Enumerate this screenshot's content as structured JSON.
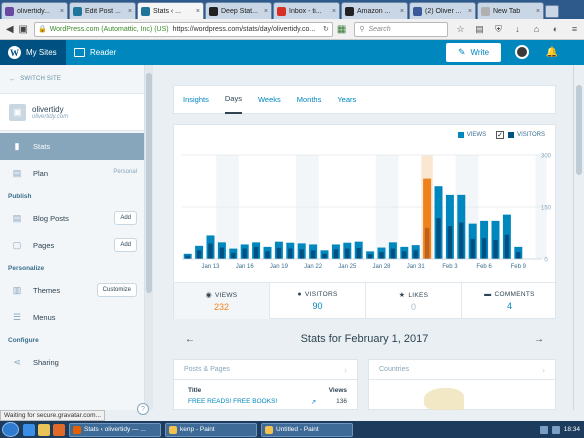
{
  "browser": {
    "tabs": [
      {
        "title": "olivertidy...",
        "favicon_color": "#6a4aa0",
        "active": false
      },
      {
        "title": "Edit Post ...",
        "favicon_color": "#21759b",
        "active": false
      },
      {
        "title": "Stats ‹ ...",
        "favicon_color": "#21759b",
        "active": true
      },
      {
        "title": "Deep Stat...",
        "favicon_color": "#222222",
        "active": false
      },
      {
        "title": "Inbox - ti...",
        "favicon_color": "#d93025",
        "active": false
      },
      {
        "title": "Amazon ...",
        "favicon_color": "#222222",
        "active": false
      },
      {
        "title": "(2) Oliver ...",
        "favicon_color": "#3b5998",
        "active": false
      },
      {
        "title": "New Tab",
        "favicon_color": "#b0b0b0",
        "active": false
      }
    ],
    "identity": "WordPress.com (Automattic, Inc) (US)",
    "url": "https://wordpress.com/stats/day/olivertidy.co...",
    "search_placeholder": "Search"
  },
  "masterbar": {
    "my_sites": "My Sites",
    "reader": "Reader",
    "write": "Write"
  },
  "sidebar": {
    "switch_site": "SWITCH SITE",
    "site_name": "olivertidy",
    "site_url": "olivertidy.com",
    "stats": "Stats",
    "plan": "Plan",
    "plan_tag": "Personal",
    "publish_header": "Publish",
    "blog_posts": "Blog Posts",
    "pages": "Pages",
    "add": "Add",
    "personalize_header": "Personalize",
    "themes": "Themes",
    "customize": "Customize",
    "menus": "Menus",
    "configure_header": "Configure",
    "sharing": "Sharing"
  },
  "period_tabs": [
    "Insights",
    "Days",
    "Weeks",
    "Months",
    "Years"
  ],
  "selected_tab": "Days",
  "chart_data": {
    "type": "bar",
    "legend": [
      "VIEWS",
      "VISITORS"
    ],
    "y_ticks": [
      "300",
      "150",
      "0"
    ],
    "ylim": [
      0,
      300
    ],
    "x_tick_labels": [
      "Jan 13",
      "Jan 16",
      "Jan 19",
      "Jan 22",
      "Jan 25",
      "Jan 28",
      "Jan 31",
      "Feb 3",
      "Feb 6",
      "Feb 9"
    ],
    "x_tick_index": [
      2,
      5,
      8,
      11,
      14,
      17,
      20,
      23,
      26,
      29
    ],
    "selected_index": 21,
    "weekend_indices": [
      3,
      4,
      10,
      11,
      17,
      18,
      24,
      25,
      31
    ],
    "series": [
      {
        "name": "VIEWS",
        "values": [
          15,
          38,
          68,
          48,
          30,
          42,
          48,
          35,
          50,
          47,
          45,
          42,
          25,
          42,
          47,
          50,
          22,
          33,
          48,
          35,
          40,
          232,
          210,
          185,
          185,
          102,
          110,
          110,
          128,
          35
        ]
      },
      {
        "name": "VISITORS",
        "values": [
          10,
          25,
          45,
          33,
          18,
          30,
          35,
          22,
          32,
          30,
          28,
          25,
          15,
          28,
          30,
          32,
          14,
          20,
          30,
          22,
          25,
          90,
          118,
          95,
          105,
          58,
          60,
          55,
          70,
          20
        ]
      }
    ],
    "colors": {
      "views": "#0087be",
      "visitors": "#005082",
      "views_selected": "#f0821e",
      "visitors_selected": "#c0611a"
    }
  },
  "summary": {
    "views_label": "VIEWS",
    "views": "232",
    "visitors_label": "VISITORS",
    "visitors": "90",
    "likes_label": "LIKES",
    "likes": "0",
    "comments_label": "COMMENTS",
    "comments": "4"
  },
  "period_title": "Stats for February 1, 2017",
  "posts_pages": {
    "header": "Posts & Pages",
    "col_title": "Title",
    "col_views": "Views",
    "rows": [
      {
        "title": "FREE READS! FREE BOOKS!",
        "views": "136"
      }
    ]
  },
  "countries": {
    "header": "Countries"
  },
  "status_text": "Waiting for secure.gravatar.com...",
  "taskbar": {
    "tasks": [
      {
        "label": "Stats ‹ olivertidy — ...",
        "color": "#e66000"
      },
      {
        "label": "kenp - Paint",
        "color": "#f2c14e"
      },
      {
        "label": "Untitled - Paint",
        "color": "#f2c14e"
      }
    ],
    "clock": "18:34"
  }
}
